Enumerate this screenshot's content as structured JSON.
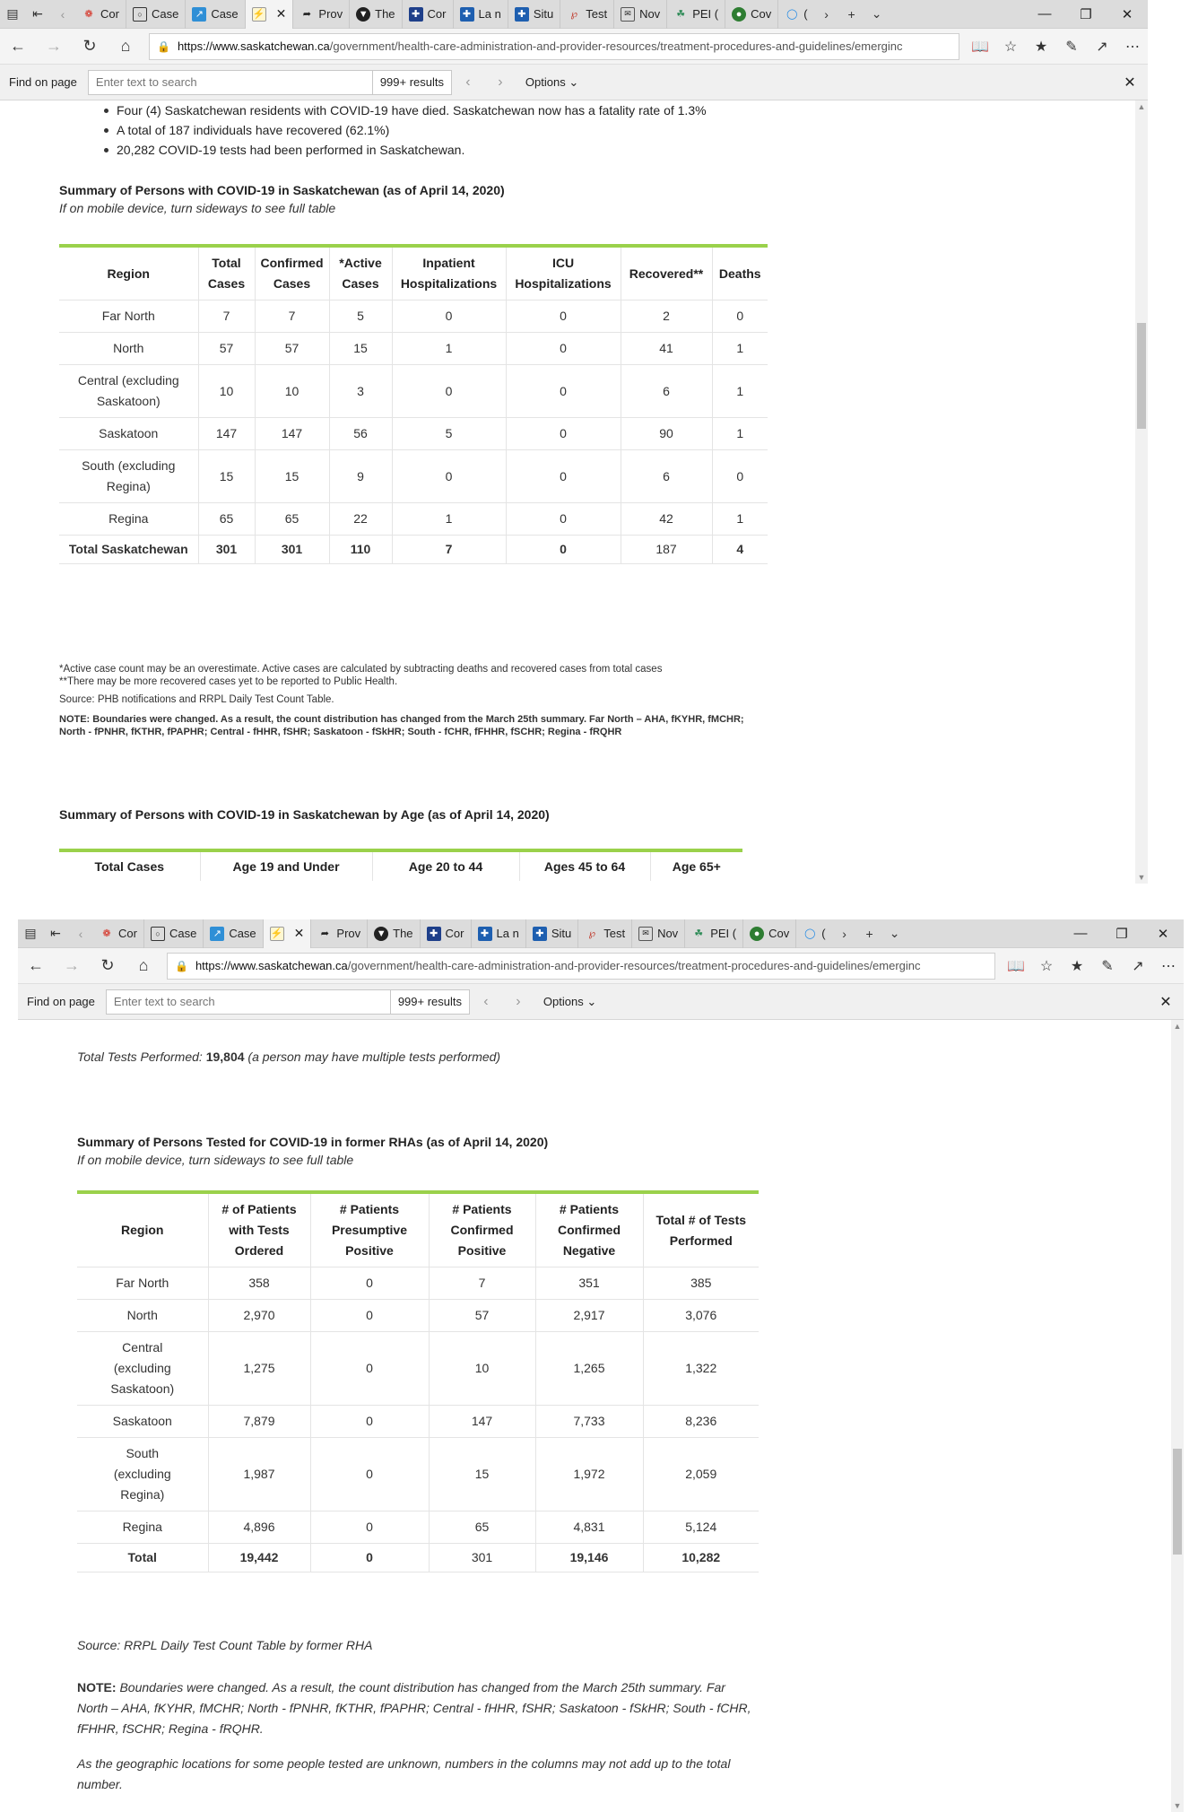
{
  "browser": {
    "tabs": [
      {
        "title": "Cor",
        "icon": "maple-leaf-icon"
      },
      {
        "title": "Case",
        "icon": "cbc-icon"
      },
      {
        "title": "Case",
        "icon": "chart-icon"
      },
      {
        "title": "",
        "icon": "page-icon",
        "active": true
      },
      {
        "title": "Prov",
        "icon": "arrow-icon"
      },
      {
        "title": "The",
        "icon": "shield-icon"
      },
      {
        "title": "Cor",
        "icon": "cross-icon"
      },
      {
        "title": "La n",
        "icon": "cross-icon"
      },
      {
        "title": "Situ",
        "icon": "cross-icon"
      },
      {
        "title": "Test",
        "icon": "test-icon"
      },
      {
        "title": "Nov",
        "icon": "news-icon"
      },
      {
        "title": "PEI (",
        "icon": "pei-icon"
      },
      {
        "title": "Cov",
        "icon": "globe-icon"
      },
      {
        "title": "(",
        "icon": "edge-icon"
      }
    ],
    "url_domain": "https://www.saskatchewan.ca",
    "url_path": "/government/health-care-administration-and-provider-resources/treatment-procedures-and-guidelines/emerginc",
    "find": {
      "label": "Find on page",
      "placeholder": "Enter text to search",
      "results": "999+ results",
      "options": "Options"
    }
  },
  "window1": {
    "bullets": [
      "Four (4) Saskatchewan residents with COVID-19 have died. Saskatchewan now has a fatality rate of 1.3%",
      "A total of 187 individuals have recovered (62.1%)",
      "20,282 COVID-19 tests had been performed in Saskatchewan."
    ],
    "summary_title": "Summary of Persons with COVID-19 in Saskatchewan (as of April 14, 2020)",
    "mobile_note": "If on mobile device, turn sideways to see full table",
    "cases_table": {
      "headers": [
        "Region",
        "Total Cases",
        "Confirmed Cases",
        "*Active Cases",
        "Inpatient Hospitalizations",
        "ICU Hospitalizations",
        "Recovered**",
        "Deaths"
      ],
      "rows": [
        [
          "Far North",
          "7",
          "7",
          "5",
          "0",
          "0",
          "2",
          "0"
        ],
        [
          "North",
          "57",
          "57",
          "15",
          "1",
          "0",
          "41",
          "1"
        ],
        [
          "Central (excluding Saskatoon)",
          "10",
          "10",
          "3",
          "0",
          "0",
          "6",
          "1"
        ],
        [
          "Saskatoon",
          "147",
          "147",
          "56",
          "5",
          "0",
          "90",
          "1"
        ],
        [
          "South (excluding Regina)",
          "15",
          "15",
          "9",
          "0",
          "0",
          "6",
          "0"
        ],
        [
          "Regina",
          "65",
          "65",
          "22",
          "1",
          "0",
          "42",
          "1"
        ]
      ],
      "total": [
        "Total Saskatchewan",
        "301",
        "301",
        "110",
        "7",
        "0",
        "187",
        "4"
      ]
    },
    "notes": {
      "active": "*Active case count may be an overestimate. Active cases are calculated by subtracting deaths and recovered cases from total cases",
      "recovered": "**There may be more recovered cases yet to be reported to Public Health.",
      "source": "Source: PHB notifications and RRPL Daily Test Count Table.",
      "boundary": "NOTE: Boundaries were changed. As a result, the count distribution has changed from the March 25th summary. Far North – AHA, fKYHR, fMCHR; North - fPNHR, fKTHR, fPAPHR; Central - fHHR, fSHR; Saskatoon - fSkHR; South - fCHR, fFHHR, fSCHR; Regina - fRQHR"
    },
    "age_title": "Summary of Persons with COVID-19 in Saskatchewan by Age (as of April 14, 2020)",
    "age_headers": [
      "Total Cases",
      "Age 19 and Under",
      "Age 20 to 44",
      "Ages 45 to 64",
      "Age 65+"
    ]
  },
  "window2": {
    "tests_prefix": "Total Tests Performed:",
    "tests_value": "19,804",
    "tests_suffix": "(a person may have multiple tests performed)",
    "summary_title": "Summary of Persons Tested for COVID-19 in former RHAs (as of April 14, 2020)",
    "mobile_note": "If on mobile device, turn sideways to see full table",
    "tests_table": {
      "headers": [
        "Region",
        "# of Patients with Tests Ordered",
        "# Patients Presumptive Positive",
        "# Patients Confirmed Positive",
        "# Patients Confirmed Negative",
        "Total # of Tests Performed"
      ],
      "rows": [
        [
          "Far North",
          "358",
          "0",
          "7",
          "351",
          "385"
        ],
        [
          "North",
          "2,970",
          "0",
          "57",
          "2,917",
          "3,076"
        ],
        [
          "Central (excluding Saskatoon)",
          "1,275",
          "0",
          "10",
          "1,265",
          "1,322"
        ],
        [
          "Saskatoon",
          "7,879",
          "0",
          "147",
          "7,733",
          "8,236"
        ],
        [
          "South (excluding Regina)",
          "1,987",
          "0",
          "15",
          "1,972",
          "2,059"
        ],
        [
          "Regina",
          "4,896",
          "0",
          "65",
          "4,831",
          "5,124"
        ]
      ],
      "total": [
        "Total",
        "19,442",
        "0",
        "301",
        "19,146",
        "10,282"
      ]
    },
    "source": "Source: RRPL Daily Test Count Table by former RHA",
    "note_label": "NOTE:",
    "note_text": "Boundaries were changed. As a result, the count distribution has changed from the March 25th summary. Far North – AHA, fKYHR, fMCHR; North - fPNHR, fKTHR, fPAPHR; Central - fHHR, fSHR; Saskatoon - fSkHR; South - fCHR, fFHHR, fSCHR; Regina - fRQHR.",
    "unknown_note": "As the geographic locations for some people tested are unknown, numbers in the columns may not add up to the total number."
  }
}
